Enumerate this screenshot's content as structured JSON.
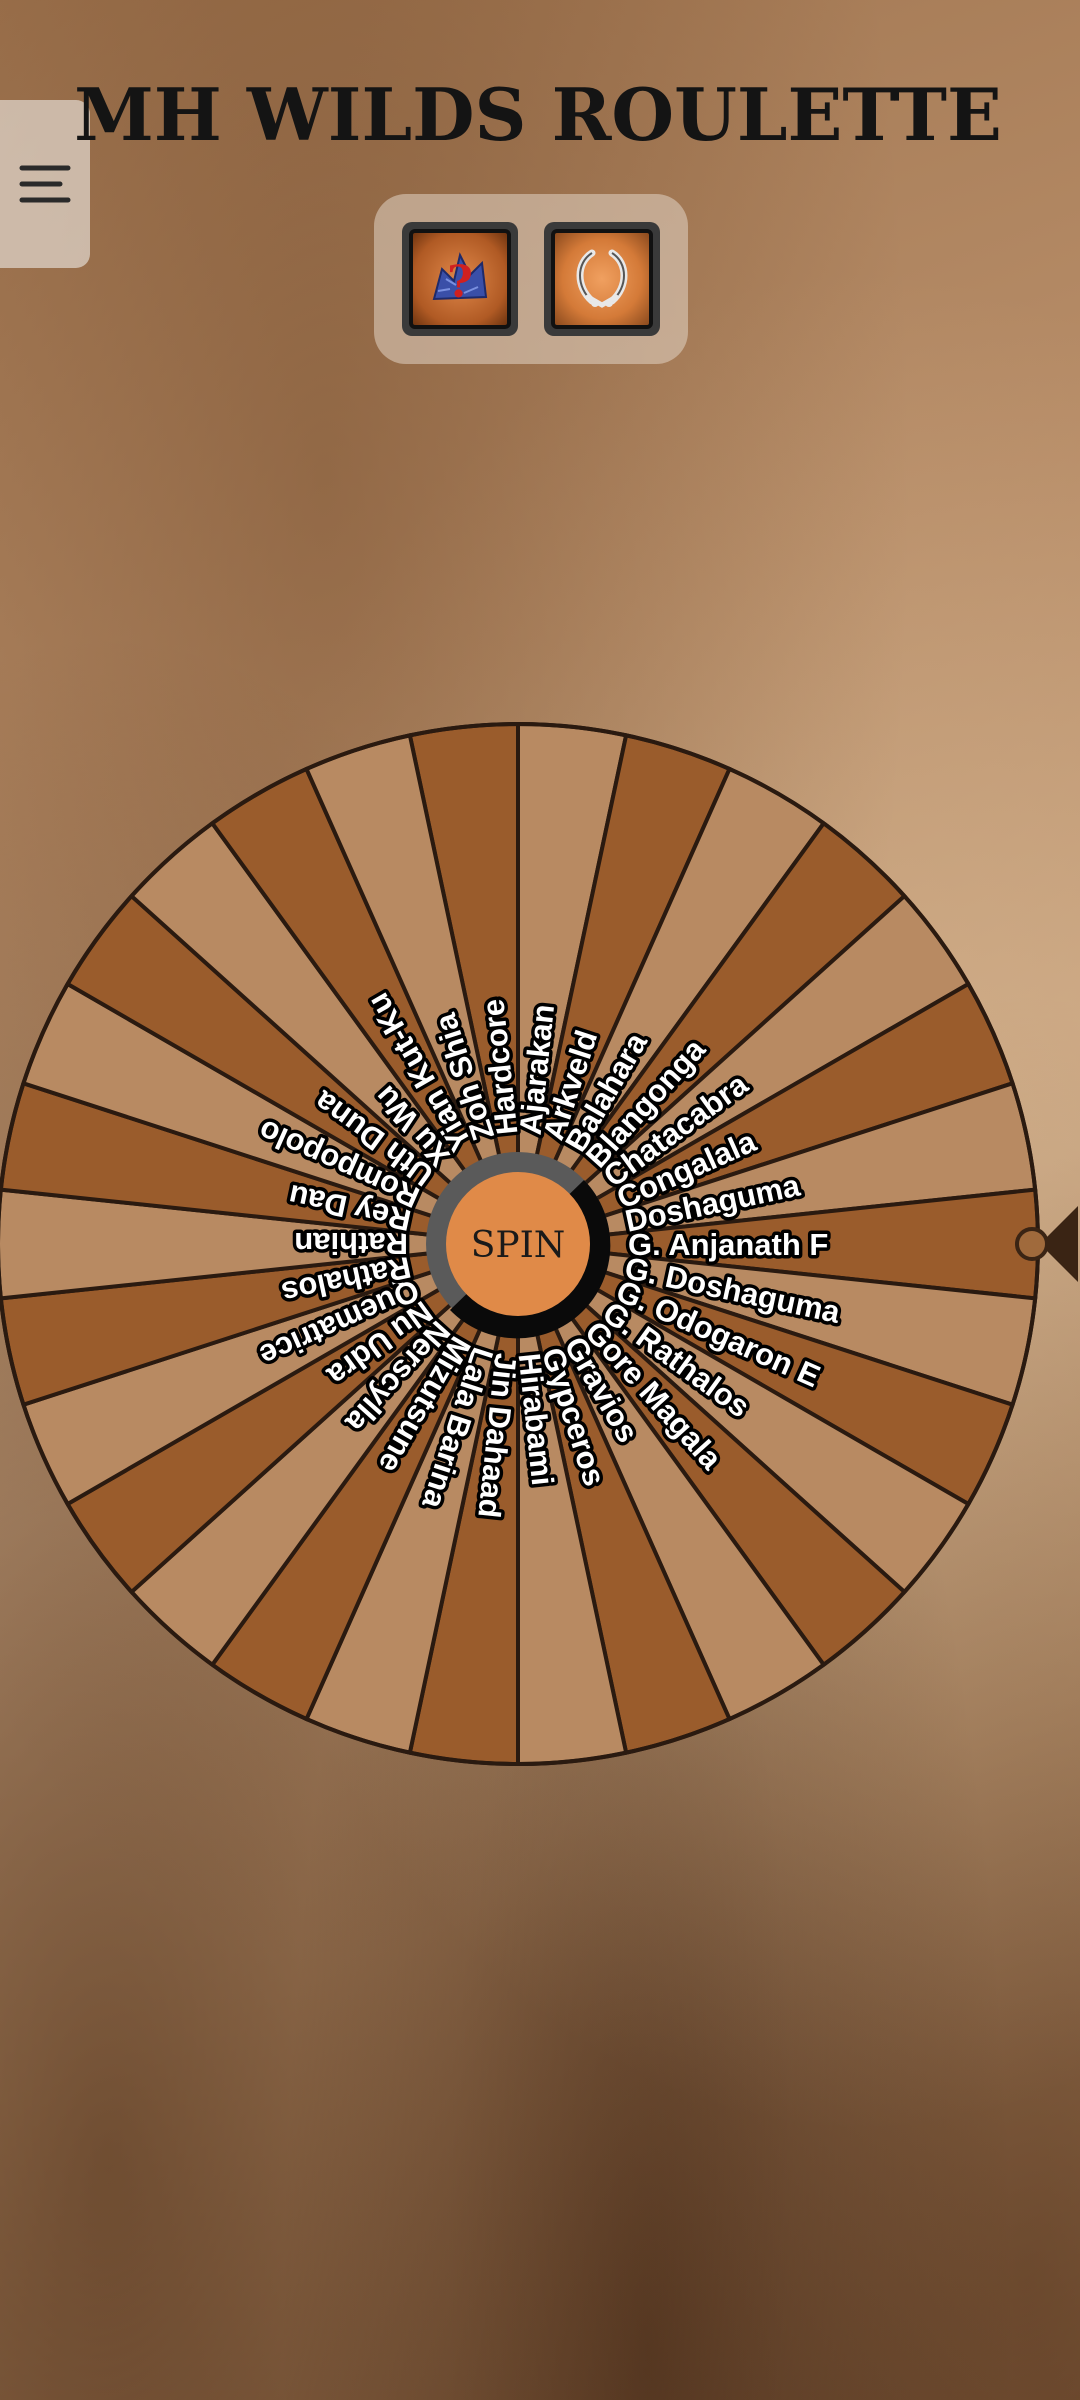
{
  "app": {
    "title": "MH WILDS ROULETTE"
  },
  "menu": {
    "icon": "hamburger-menu-icon"
  },
  "icons": [
    {
      "name": "random-monster-icon"
    },
    {
      "name": "claws-icon"
    }
  ],
  "wheel": {
    "spin_label": "SPIN",
    "colors": {
      "dark": "#9a5c2c",
      "light": "#b88a62",
      "divider": "#2a1a10",
      "hub": "#e08a48",
      "pointer": "#3a2414"
    },
    "segments": [
      "Hardcore",
      "Ajarakan",
      "Arkveld",
      "Balahara",
      "Blangonga",
      "Chatacabra",
      "Congalala",
      "Doshaguma",
      "G. Anjanath F",
      "G. Doshaguma",
      "G. Odogaron E",
      "G. Rathalos",
      "Gore Magala",
      "Gravios",
      "Gypceros",
      "Hirabami",
      "Jin Dahaad",
      "Lala Barina",
      "Mizutsune",
      "Nerscylla",
      "Nu Udra",
      "Quematrice",
      "Rathalos",
      "Rathian",
      "Rey Dau",
      "Rompopolo",
      "Uth Duna",
      "Xu Wu",
      "Yian Kut-Ku",
      "Zoh Shia"
    ]
  }
}
